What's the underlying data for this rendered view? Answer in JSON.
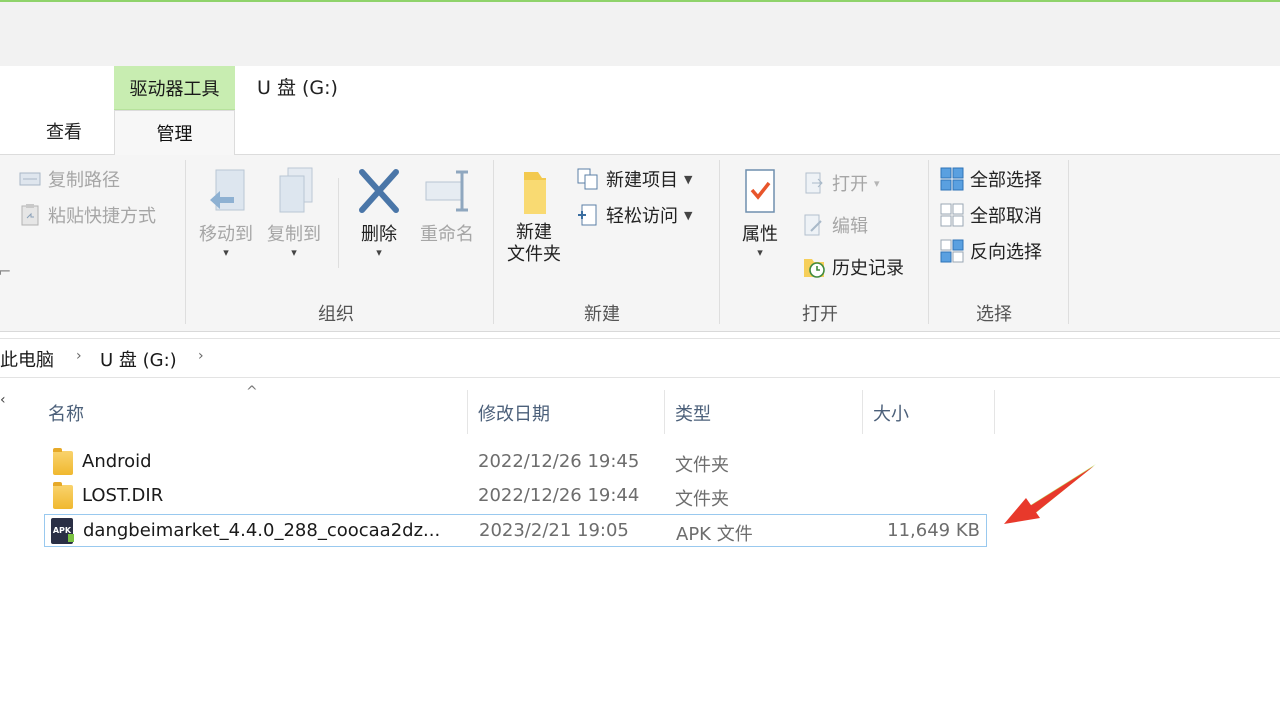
{
  "ribbon_tabs": {
    "context_group": "驱动器工具",
    "view": "查看",
    "manage": "管理"
  },
  "window": {
    "title": "U 盘 (G:)"
  },
  "clipboard": {
    "copy_path": "复制路径",
    "paste_shortcut": "粘贴快捷方式"
  },
  "organize": {
    "move_to": "移动到",
    "copy_to": "复制到",
    "delete": "删除",
    "rename": "重命名",
    "label": "组织"
  },
  "new": {
    "new_folder_line1": "新建",
    "new_folder_line2": "文件夹",
    "new_item": "新建项目",
    "easy_access": "轻松访问",
    "label": "新建"
  },
  "open": {
    "properties": "属性",
    "open": "打开",
    "edit": "编辑",
    "history": "历史记录",
    "label": "打开"
  },
  "select": {
    "select_all": "全部选择",
    "select_none": "全部取消",
    "invert": "反向选择",
    "label": "选择"
  },
  "breadcrumb": {
    "this_pc": "此电脑",
    "drive": "U 盘 (G:)"
  },
  "columns": {
    "name": "名称",
    "date": "修改日期",
    "type": "类型",
    "size": "大小"
  },
  "files": [
    {
      "name": "Android",
      "date": "2022/12/26 19:45",
      "type": "文件夹",
      "size": ""
    },
    {
      "name": "LOST.DIR",
      "date": "2022/12/26 19:44",
      "type": "文件夹",
      "size": ""
    },
    {
      "name": "dangbeimarket_4.4.0_288_coocaa2dz...",
      "date": "2023/2/21 19:05",
      "type": "APK 文件",
      "size": "11,649 KB",
      "icon_text": "APK"
    }
  ],
  "colors": {
    "context_tab": "#c8edb1",
    "accent_arrow": "#e8392b",
    "selection_border": "#99c9ef"
  }
}
